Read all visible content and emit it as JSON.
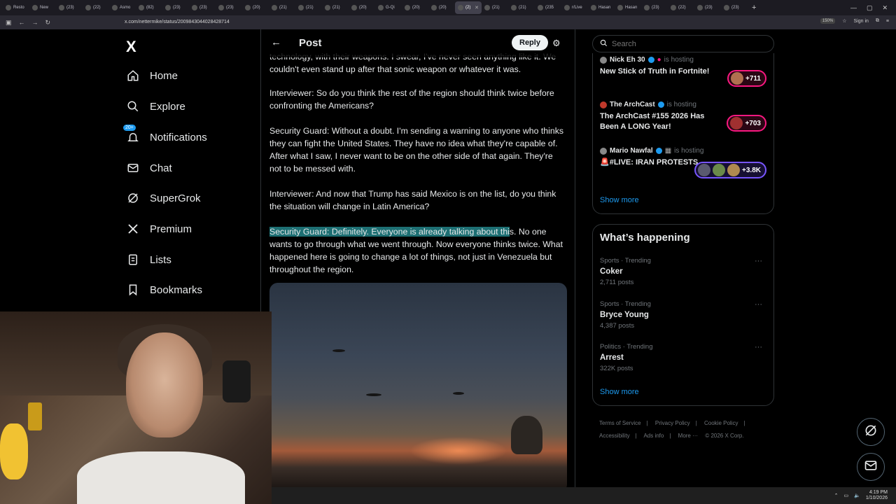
{
  "browser": {
    "tabs": [
      "Resto",
      "New",
      "(23)",
      "(22)",
      "Asmo",
      "(82)",
      "(23)",
      "(23)",
      "(23)",
      "(20)",
      "(21)",
      "(21)",
      "(21)",
      "(20)",
      "G-Qi",
      "(20)",
      "(20)",
      "(2)",
      "(21)",
      "(21)",
      "(235",
      "r/Live",
      "Hasan",
      "Hasan",
      "(23)",
      "(22)",
      "(23)",
      "(23)"
    ],
    "url": "x.com/nettermike/status/2009843044028428714",
    "zoom": "150%",
    "sign_in": "Sign in"
  },
  "nav": {
    "logo": "X",
    "items": [
      {
        "label": "Home"
      },
      {
        "label": "Explore"
      },
      {
        "label": "Notifications",
        "badge": "20+"
      },
      {
        "label": "Chat"
      },
      {
        "label": "SuperGrok"
      },
      {
        "label": "Premium"
      },
      {
        "label": "Lists"
      },
      {
        "label": "Bookmarks"
      }
    ]
  },
  "post": {
    "title": "Post",
    "reply_label": "Reply",
    "para0": "technology, with their weapons. I swear, I've never seen anything like it. We couldn't even stand up after that sonic weapon or whatever it was.",
    "para1": "Interviewer: So do you think the rest of the region should think twice before confronting the Americans?",
    "para2": "Security Guard: Without a doubt. I'm sending a warning to anyone who thinks they can fight the United States. They have no idea what they're capable of. After what I saw, I never want to be on the other side of that again. They're not to be messed with.",
    "para3": "Interviewer: And now that Trump has said Mexico is on the list, do you think the situation will change in Latin America?",
    "para4_highlight": "Security Guard: Definitely. Everyone is already talking about thi",
    "para4_rest": "s. No one wants to go through what we went through. Now everyone thinks twice. What happened here is going to change a lot of things, not just in Venezuela but throughout the region."
  },
  "search": {
    "placeholder": "Search"
  },
  "spaces": [
    {
      "host": "Nick Eh 30",
      "hosting": "is hosting",
      "title": "New Stick of Truth in Fortnite!",
      "listeners": "+711",
      "accent": "#f91880"
    },
    {
      "host": "The ArchCast",
      "hosting": "is hosting",
      "title": "The ArchCast #155 2026 Has Been A LONG Year!",
      "listeners": "+703",
      "accent": "#f91880"
    },
    {
      "host": "Mario Nawfal",
      "hosting": "is hosting",
      "title": "🚨#LIVE: IRAN PROTESTS",
      "listeners": "+3.8K",
      "accent": "#7856ff"
    }
  ],
  "spaces_show_more": "Show more",
  "happening": {
    "title": "What’s happening",
    "trends": [
      {
        "category": "Sports · Trending",
        "name": "Coker",
        "count": "2,711 posts"
      },
      {
        "category": "Sports · Trending",
        "name": "Bryce Young",
        "count": "4,387 posts"
      },
      {
        "category": "Politics · Trending",
        "name": "Arrest",
        "count": "322K posts"
      }
    ],
    "show_more": "Show more"
  },
  "footer": {
    "links": [
      "Terms of Service",
      "|",
      "Privacy Policy",
      "|",
      "Cookie Policy",
      "|",
      "Accessibility",
      "|",
      "Ads info",
      "|",
      "More ···",
      "© 2026 X Corp."
    ]
  },
  "taskbar": {
    "time": "4:19 PM",
    "date": "1/10/2026"
  }
}
